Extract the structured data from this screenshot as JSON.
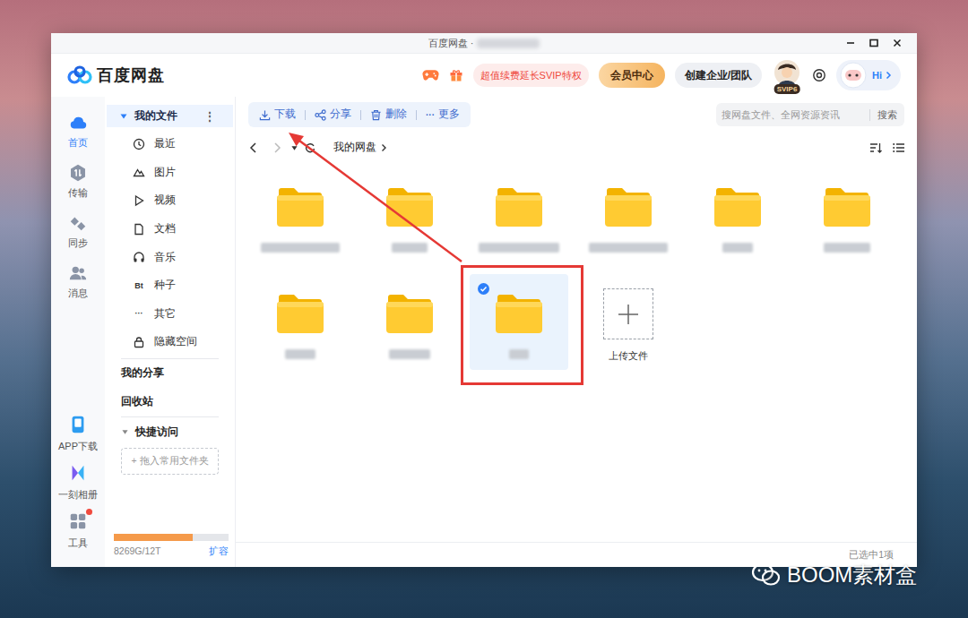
{
  "window": {
    "title": "百度网盘 ·"
  },
  "header": {
    "logo": "百度网盘",
    "promo": "超值续费延长SVIP特权",
    "vip_center": "会员中心",
    "team": "创建企业/团队",
    "badge": "SVIP6",
    "greeting": "Hi"
  },
  "nav": {
    "top": [
      {
        "label": "首页",
        "selected": true
      },
      {
        "label": "传输",
        "selected": false
      },
      {
        "label": "同步",
        "selected": false
      },
      {
        "label": "消息",
        "selected": false
      }
    ],
    "bottom": [
      {
        "label": "APP下载",
        "badge": false
      },
      {
        "label": "一刻相册",
        "badge": false
      },
      {
        "label": "工具",
        "badge": true
      }
    ]
  },
  "sidebar": {
    "my_files": {
      "label": "我的文件",
      "expanded": true,
      "selected": true,
      "menu": "⋮"
    },
    "items": [
      {
        "label": "最近"
      },
      {
        "label": "图片"
      },
      {
        "label": "视频"
      },
      {
        "label": "文档"
      },
      {
        "label": "音乐"
      },
      {
        "label": "种子",
        "glyph": "Bt"
      },
      {
        "label": "其它",
        "glyph": "···"
      },
      {
        "label": "隐藏空间"
      }
    ],
    "links": [
      "我的分享",
      "回收站"
    ],
    "quick": {
      "label": "快捷访问",
      "expanded": true,
      "add": "+ 拖入常用文件夹"
    },
    "storage": {
      "level": 0.69,
      "text": "8269G/12T",
      "expand": "扩容"
    }
  },
  "toolbar": {
    "actions": [
      {
        "label": "下载"
      },
      {
        "label": "分享"
      },
      {
        "label": "删除"
      },
      {
        "label": "更多",
        "glyph": "···"
      }
    ],
    "search": {
      "placeholder": "搜网盘文件、全网资源资讯",
      "button": "搜索"
    }
  },
  "breadcrumb": {
    "path": "我的网盘"
  },
  "files": [
    {
      "selected": false
    },
    {
      "selected": false
    },
    {
      "selected": false
    },
    {
      "selected": false
    },
    {
      "selected": false
    },
    {
      "selected": false
    },
    {
      "selected": false
    },
    {
      "selected": false
    },
    {
      "selected": true
    }
  ],
  "upload": "上传文件",
  "status_bar": "已选中1项",
  "watermark": "BOOM素材盒"
}
